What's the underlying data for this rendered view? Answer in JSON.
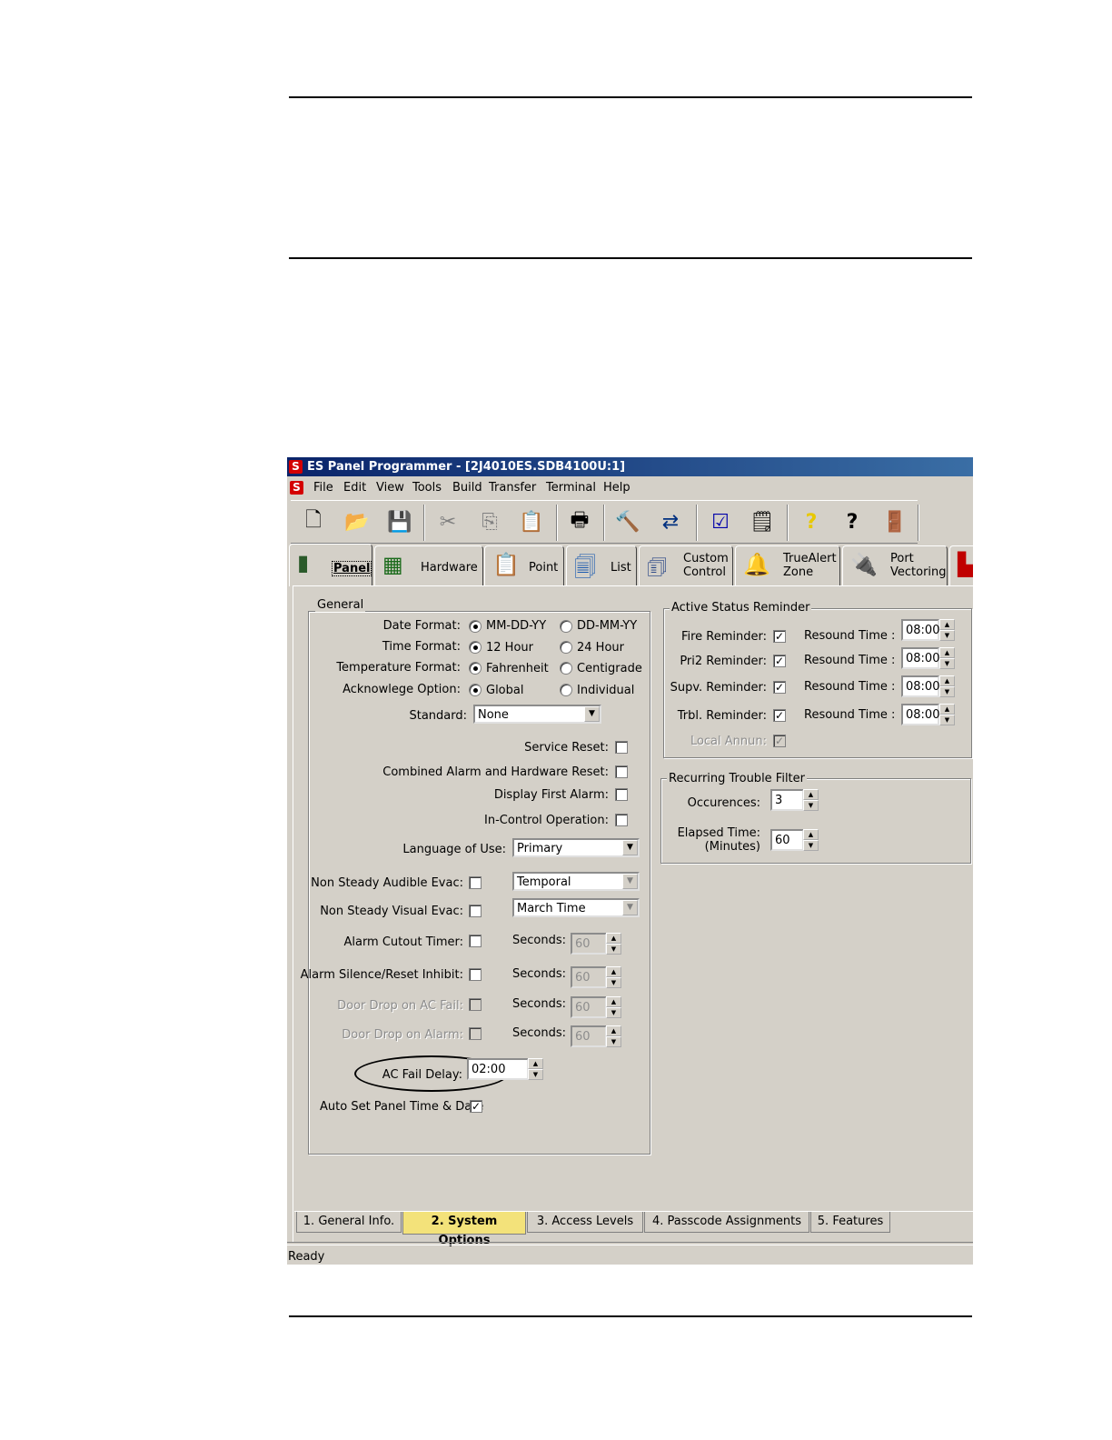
{
  "window": {
    "title": "ES Panel Programmer - [2J4010ES.SDB4100U:1]",
    "logo_letter": "S"
  },
  "menu": [
    "File",
    "Edit",
    "View",
    "Tools",
    "Build",
    "Transfer",
    "Terminal",
    "Help"
  ],
  "toolbar": [
    {
      "icon": "new-document-icon",
      "glyph": "🗋"
    },
    {
      "icon": "open-folder-icon",
      "glyph": "📂"
    },
    {
      "icon": "save-disk-icon",
      "glyph": "💾"
    },
    {
      "icon": "cut-scissors-icon",
      "glyph": "✂"
    },
    {
      "icon": "copy-icon",
      "glyph": "⎘"
    },
    {
      "icon": "paste-icon",
      "glyph": "📋"
    },
    {
      "icon": "print-icon",
      "glyph": "🖶"
    },
    {
      "icon": "build-hammer-icon",
      "glyph": "🔨"
    },
    {
      "icon": "transfer-icon",
      "glyph": "⇄"
    },
    {
      "icon": "checklist-icon",
      "glyph": "☑"
    },
    {
      "icon": "notes-icon",
      "glyph": "🗒"
    },
    {
      "icon": "help-question-icon",
      "glyph": "?"
    },
    {
      "icon": "whats-this-icon",
      "glyph": "?"
    },
    {
      "icon": "exit-door-icon",
      "glyph": "🚪"
    }
  ],
  "tabs": [
    {
      "label": "Panel"
    },
    {
      "label": "Hardware"
    },
    {
      "label": "Point"
    },
    {
      "label": "List"
    },
    {
      "label1": "Custom",
      "label2": "Control"
    },
    {
      "label1": "TrueAlert",
      "label2": "Zone"
    },
    {
      "label1": "Port",
      "label2": "Vectoring"
    }
  ],
  "general": {
    "title": "General",
    "date_format": {
      "label": "Date Format:",
      "opt1": "MM-DD-YY",
      "opt2": "DD-MM-YY"
    },
    "time_format": {
      "label": "Time Format:",
      "opt1": "12 Hour",
      "opt2": "24 Hour"
    },
    "temp_format": {
      "label": "Temperature Format:",
      "opt1": "Fahrenheit",
      "opt2": "Centigrade"
    },
    "ack_option": {
      "label": "Acknowlege Option:",
      "opt1": "Global",
      "opt2": "Individual"
    },
    "standard": {
      "label": "Standard:",
      "value": "None"
    },
    "service_reset": "Service Reset:",
    "combined_reset": "Combined Alarm and Hardware Reset:",
    "display_first": "Display First Alarm:",
    "in_control": "In-Control Operation:",
    "language": {
      "label": "Language of Use:",
      "value": "Primary"
    },
    "audible_evac": {
      "label": "Non Steady Audible Evac:",
      "value": "Temporal"
    },
    "visual_evac": {
      "label": "Non Steady Visual Evac:",
      "value": "March Time"
    },
    "alarm_cutout": {
      "label": "Alarm Cutout Timer:",
      "seconds": "Seconds:",
      "value": "60"
    },
    "silence_inhibit": {
      "label": "Alarm Silence/Reset Inhibit:",
      "seconds": "Seconds:",
      "value": "60"
    },
    "door_ac": {
      "label": "Door Drop on AC Fail:",
      "seconds": "Seconds:",
      "value": "60"
    },
    "door_alarm": {
      "label": "Door Drop on Alarm:",
      "seconds": "Seconds:",
      "value": "60"
    },
    "ac_fail": {
      "label": "AC Fail Delay:",
      "value": "02:00"
    },
    "auto_set": "Auto Set Panel Time & Date"
  },
  "reminder": {
    "title": "Active Status Reminder",
    "resound": "Resound Time :",
    "rows": [
      {
        "label": "Fire Reminder:",
        "time": "08:00"
      },
      {
        "label": "Pri2 Reminder:",
        "time": "08:00"
      },
      {
        "label": "Supv. Reminder:",
        "time": "08:00"
      },
      {
        "label": "Trbl. Reminder:",
        "time": "08:00"
      }
    ],
    "local_annun": "Local Annun:"
  },
  "trouble_filter": {
    "title": "Recurring Trouble Filter",
    "occurrences": {
      "label": "Occurences:",
      "value": "3"
    },
    "elapsed1": "Elapsed Time:",
    "elapsed2": "(Minutes)",
    "elapsed_value": "60"
  },
  "bottom_tabs": [
    "1. General Info.",
    "2. System Options",
    "3. Access Levels",
    "4. Passcode Assignments",
    "5. Features"
  ],
  "status": "Ready",
  "colors": {
    "active_tab": "#f3e27a",
    "titlebar": "#0a246a",
    "face": "#d4d0c8"
  }
}
